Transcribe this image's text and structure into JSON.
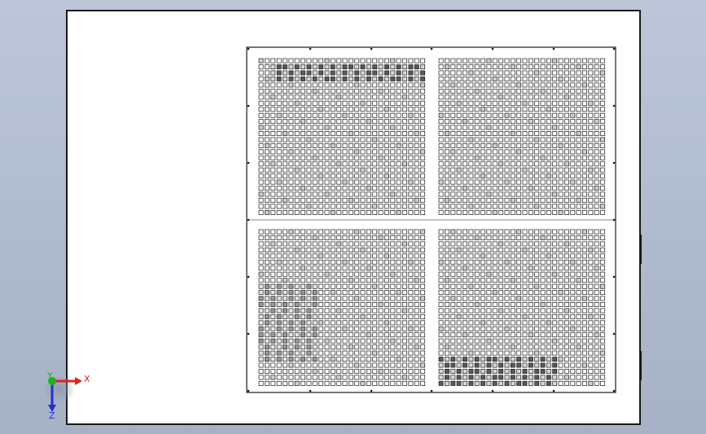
{
  "viewport": {
    "background_top": "#bcc6d8",
    "background_bottom": "#a6b1c6"
  },
  "model": {
    "face_color": "#ffffff",
    "edge_color": "#1a1a1a",
    "perforated_panel": {
      "quadrants": 4,
      "rows_per_quadrant": 26,
      "cols_per_quadrant": 28
    }
  },
  "triad": {
    "x_label": "X",
    "y_label": "Y",
    "z_label": "Z",
    "x_color": "#e02020",
    "y_color": "#20b020",
    "z_color": "#2030d0"
  }
}
